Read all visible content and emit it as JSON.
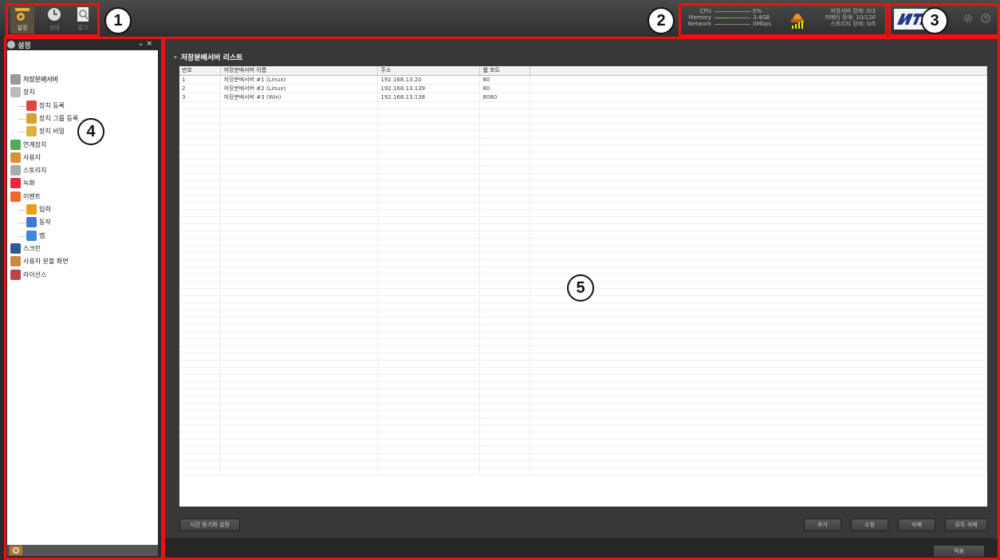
{
  "toolbar": {
    "buttons": [
      {
        "label": "설정",
        "active": true,
        "icon": "settings-icon"
      },
      {
        "label": "상태",
        "active": false,
        "icon": "status-clock-icon"
      },
      {
        "label": "로그",
        "active": false,
        "icon": "log-magnifier-icon"
      }
    ]
  },
  "annotations": [
    "1",
    "2",
    "3",
    "4",
    "5"
  ],
  "system_stats": [
    {
      "name": "CPU",
      "value": "0%"
    },
    {
      "name": "Memory",
      "value": "3.4GB"
    },
    {
      "name": "Network",
      "value": "0Mbps"
    }
  ],
  "alarm_status": {
    "lines": [
      "저장서버 장애: 0/3",
      "카메라 장애: 10/120",
      "스토리지 장애: 0/5"
    ]
  },
  "left_panel": {
    "title": "설정",
    "collapse": "⌄ ×",
    "tree": [
      {
        "label": "저장분배서버",
        "level": 0,
        "selected": true,
        "icon": "server-icon"
      },
      {
        "label": "장치",
        "level": 0,
        "icon": "camera-device-icon"
      },
      {
        "label": "장치 등록",
        "level": 1,
        "icon": "device-register-icon"
      },
      {
        "label": "장치 그룹 등록",
        "level": 1,
        "icon": "device-group-icon"
      },
      {
        "label": "장치 비밀",
        "level": 1,
        "icon": "device-password-icon"
      },
      {
        "label": "연계장치",
        "level": 0,
        "icon": "linked-device-icon"
      },
      {
        "label": "사용자",
        "level": 0,
        "icon": "user-icon"
      },
      {
        "label": "스토리지",
        "level": 0,
        "icon": "storage-icon"
      },
      {
        "label": "녹화",
        "level": 0,
        "icon": "record-icon"
      },
      {
        "label": "이벤트",
        "level": 0,
        "icon": "event-icon"
      },
      {
        "label": "입력",
        "level": 1,
        "icon": "warning-input-icon"
      },
      {
        "label": "동작",
        "level": 1,
        "icon": "action-check-icon"
      },
      {
        "label": "맵",
        "level": 1,
        "icon": "map-icon"
      },
      {
        "label": "스크린",
        "level": 0,
        "icon": "screen-icon"
      },
      {
        "label": "사용자 분할 화면",
        "level": 0,
        "icon": "user-layout-icon"
      },
      {
        "label": "라이선스",
        "level": 0,
        "icon": "license-icon"
      }
    ]
  },
  "main": {
    "title": "저장분배서버 리스트",
    "columns": [
      "번호",
      "저장분배서버 이름",
      "주소",
      "웹 포트",
      ""
    ],
    "rows": [
      [
        "1",
        "저장분배서버 #1 (Linux)",
        "192.168.13.20",
        "80",
        ""
      ],
      [
        "2",
        "저장분배서버 #2 (Linux)",
        "192.168.13.139",
        "80",
        ""
      ],
      [
        "3",
        "저장분배서버 #3 (Win)",
        "192.168.13.138",
        "8080",
        ""
      ]
    ],
    "buttons": {
      "time_sync": "시간 동기화 설정",
      "add": "추가",
      "edit": "수정",
      "delete": "삭제",
      "delete_all": "모두 삭제",
      "apply": "적용"
    }
  },
  "colors": {
    "highlight": "#e11111",
    "accent": "#66aabb"
  }
}
